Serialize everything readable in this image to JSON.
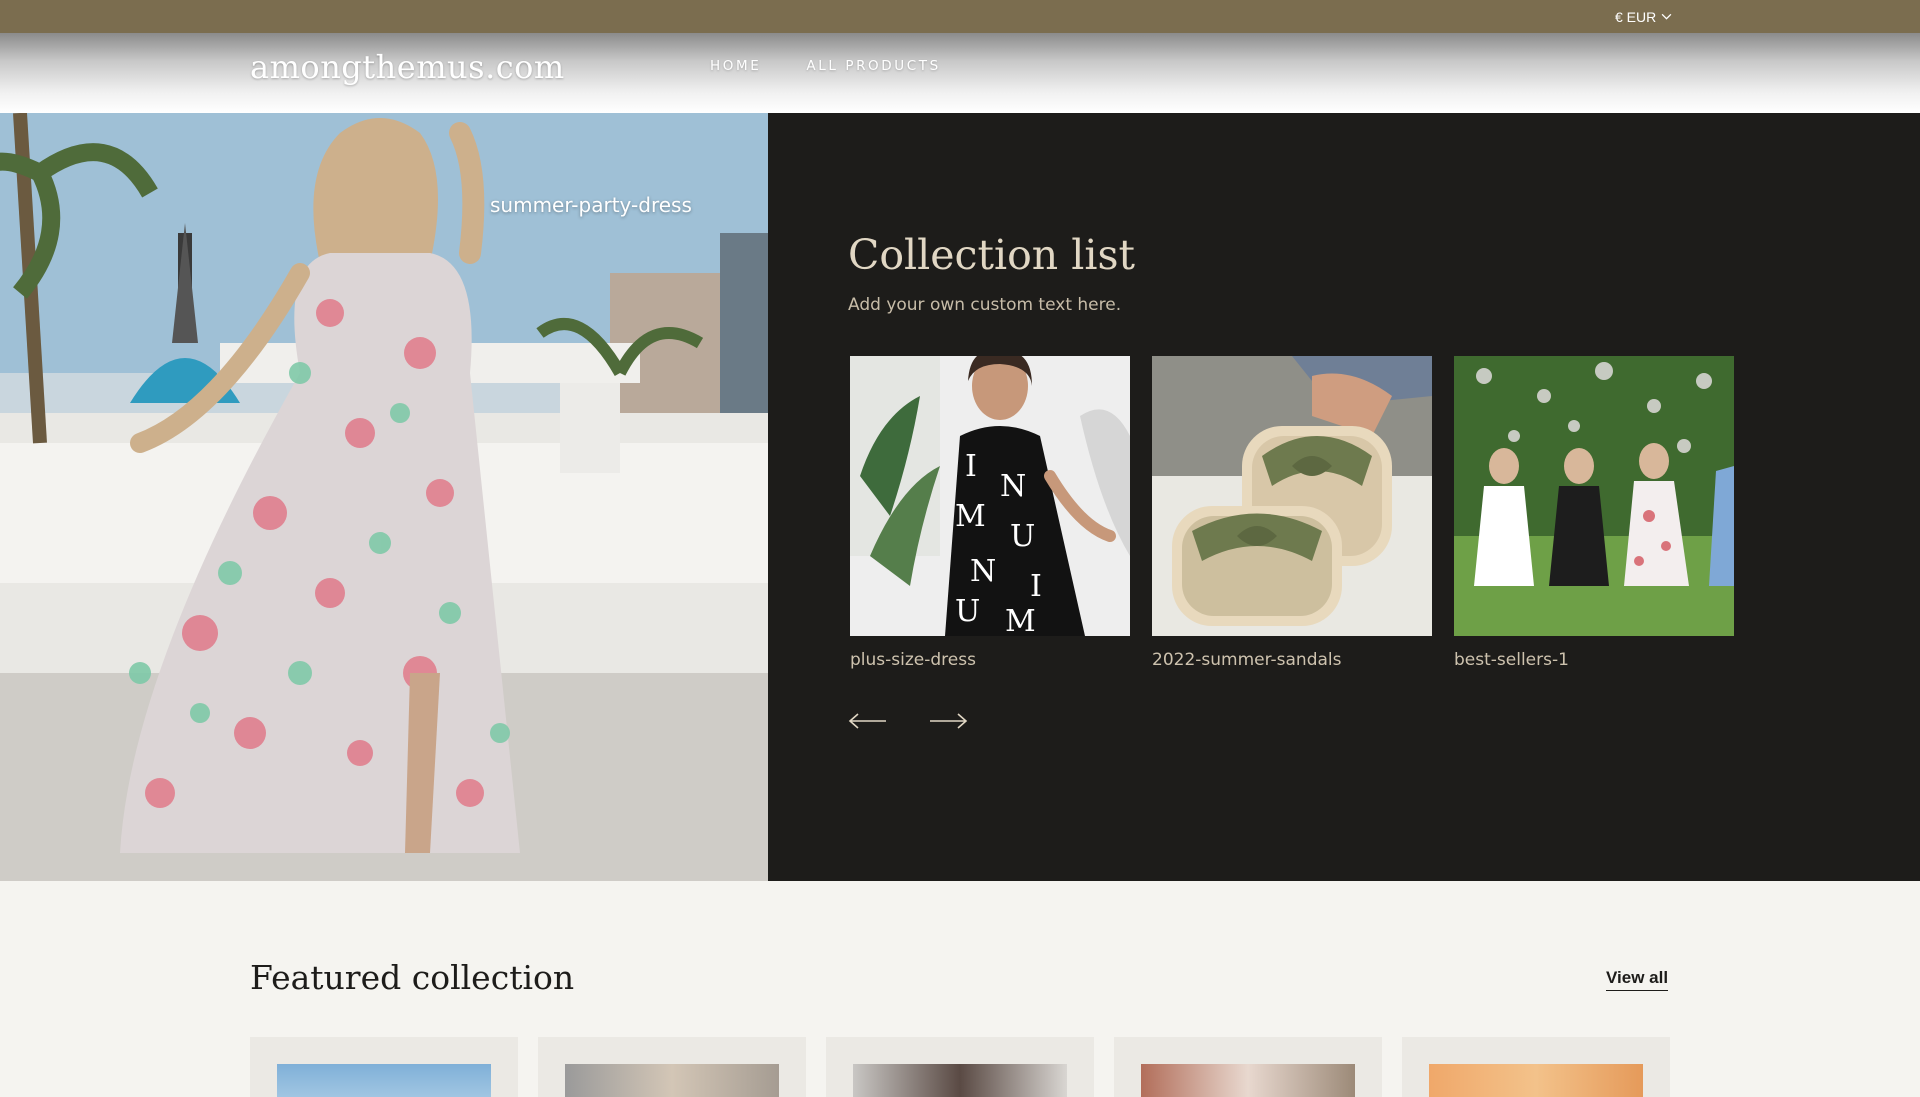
{
  "topbar": {
    "currency": "€ EUR",
    "currency_icon": "chevron-down-icon"
  },
  "header": {
    "logo": "amongthemus.com",
    "nav": [
      "HOME",
      "ALL PRODUCTS"
    ]
  },
  "hero": {
    "caption": "summer-party-dress",
    "panel": {
      "title": "Collection list",
      "subtitle": "Add your own custom text here.",
      "collections": [
        {
          "label": "plus-size-dress"
        },
        {
          "label": "2022-summer-sandals"
        },
        {
          "label": "best-sellers-1"
        }
      ],
      "prev_icon": "arrow-left-icon",
      "next_icon": "arrow-right-icon"
    }
  },
  "featured": {
    "title": "Featured collection",
    "view_all": "View all"
  },
  "colors": {
    "topbar": "#7b6d4f",
    "panel_bg": "#1d1c1a",
    "panel_text": "#e1d7c4",
    "page_bg": "#f5f4f0"
  }
}
